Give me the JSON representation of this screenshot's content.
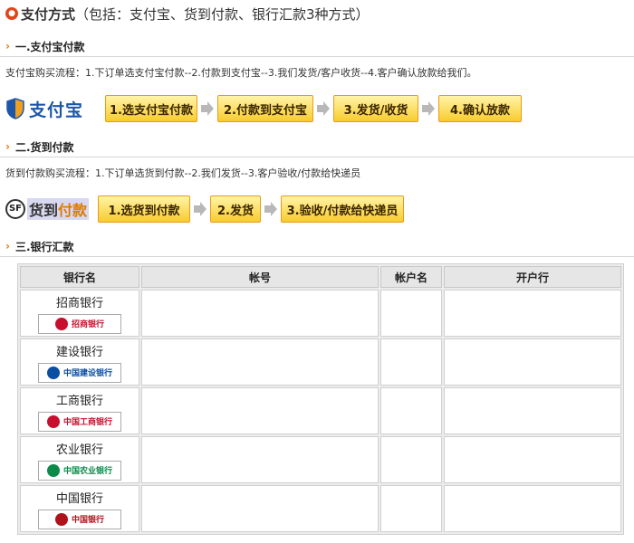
{
  "page": {
    "title": "支付方式",
    "subtitle": "（包括：支付宝、货到付款、银行汇款3种方式）"
  },
  "alipay": {
    "heading": "一.支付宝付款",
    "description": "支付宝购买流程：1.下订单选支付宝付款--2.付款到支付宝--3.我们发货/客户收货--4.客户确认放款给我们。",
    "logo_text": "支付宝",
    "steps": [
      "1.选支付宝付款",
      "2.付款到支付宝",
      "3.发货/收货",
      "4.确认放款"
    ]
  },
  "cod": {
    "heading": "二.货到付款",
    "description": "货到付款购买流程：1.下订单选货到付款--2.我们发货--3.客户验收/付款给快递员",
    "logo_mark": "SF",
    "logo_text_a": "货到",
    "logo_text_b": "付款",
    "steps": [
      "1.选货到付款",
      "2.发货",
      "3.验收/付款给快递员"
    ]
  },
  "bank": {
    "heading": "三.银行汇款",
    "columns": [
      "银行名",
      "帐号",
      "帐户名",
      "开户行"
    ],
    "rows": [
      {
        "name": "招商银行",
        "logo": "招商银行",
        "color": "#c8102e"
      },
      {
        "name": "建设银行",
        "logo": "中国建设银行",
        "color": "#0a4ea2"
      },
      {
        "name": "工商银行",
        "logo": "中国工商银行",
        "color": "#c8102e"
      },
      {
        "name": "农业银行",
        "logo": "中国农业银行",
        "color": "#0b8a4a"
      },
      {
        "name": "中国银行",
        "logo": "中国银行",
        "color": "#b0121b"
      }
    ]
  },
  "colors": {
    "accent": "#e87a10",
    "step_border": "#e89b1d"
  }
}
